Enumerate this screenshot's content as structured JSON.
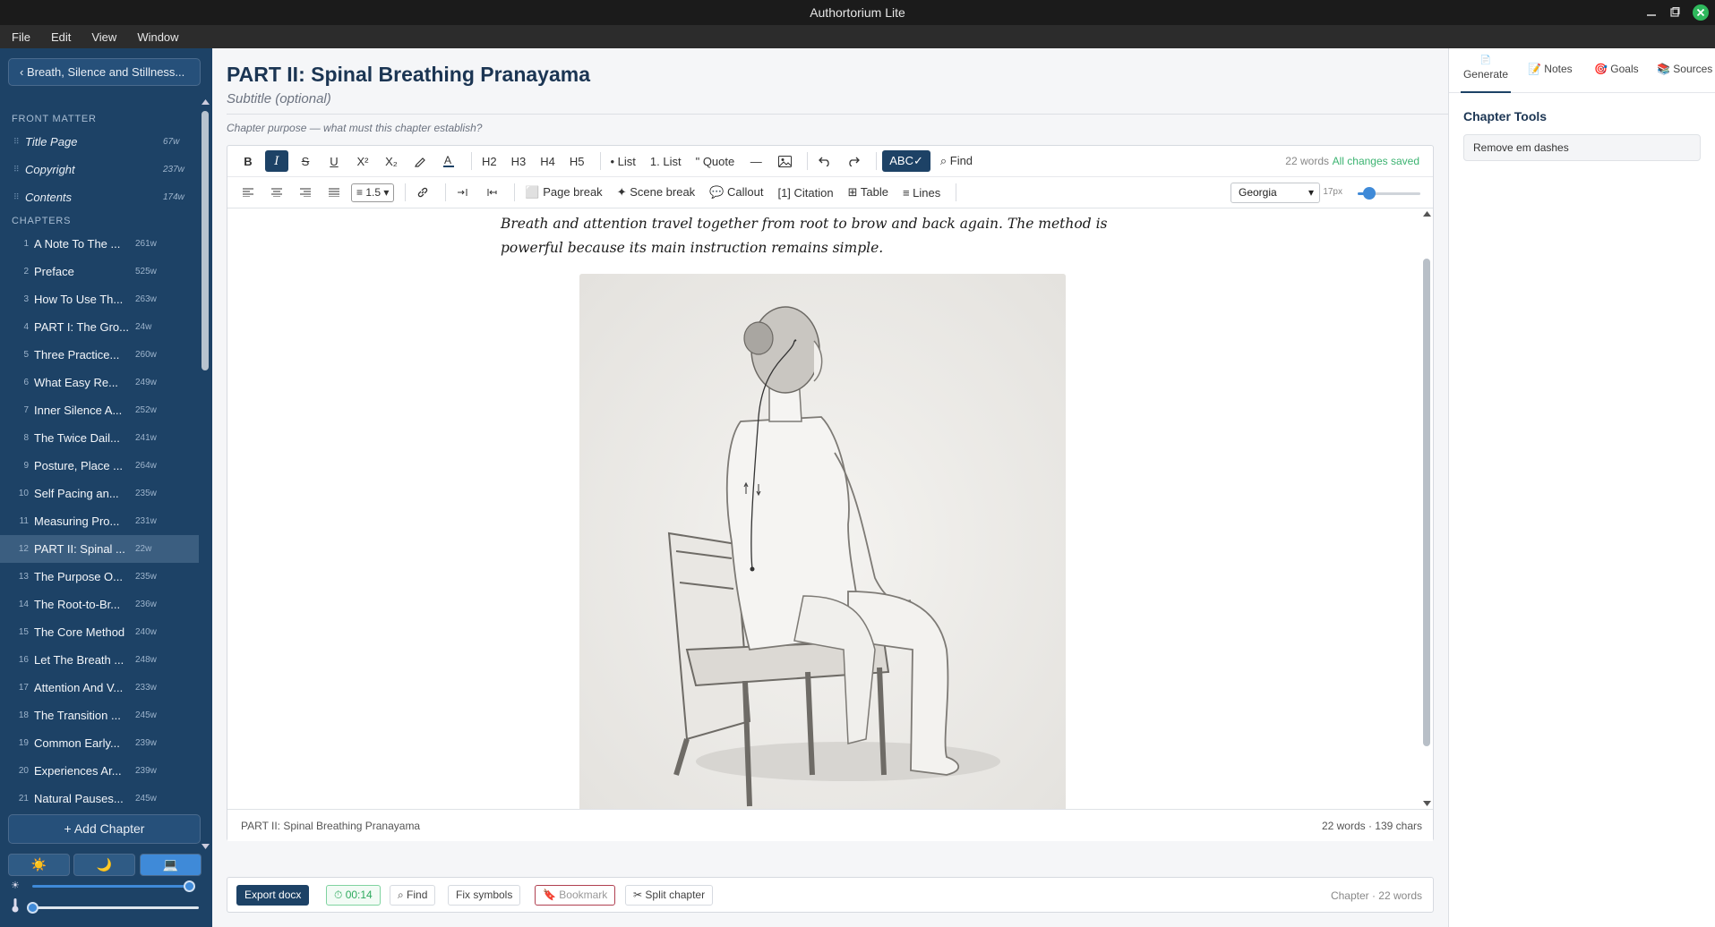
{
  "window": {
    "title": "Authortorium Lite"
  },
  "menu": [
    "File",
    "Edit",
    "View",
    "Window"
  ],
  "sidebar": {
    "back_label": "‹  Breath, Silence and Stillness...",
    "front_matter_heading": "FRONT MATTER",
    "front_matter": [
      {
        "title": "Title Page",
        "words": "67w"
      },
      {
        "title": "Copyright",
        "words": "237w"
      },
      {
        "title": "Contents",
        "words": "174w"
      }
    ],
    "chapters_heading": "CHAPTERS",
    "chapters": [
      {
        "n": "1",
        "title": "A Note To The ...",
        "words": "261w"
      },
      {
        "n": "2",
        "title": "Preface",
        "words": "525w"
      },
      {
        "n": "3",
        "title": "How To Use Th...",
        "words": "263w"
      },
      {
        "n": "4",
        "title": "PART I: The Gro...",
        "words": "24w"
      },
      {
        "n": "5",
        "title": "Three Practice...",
        "words": "260w"
      },
      {
        "n": "6",
        "title": "What Easy Re...",
        "words": "249w"
      },
      {
        "n": "7",
        "title": "Inner Silence A...",
        "words": "252w"
      },
      {
        "n": "8",
        "title": "The Twice Dail...",
        "words": "241w"
      },
      {
        "n": "9",
        "title": "Posture, Place ...",
        "words": "264w"
      },
      {
        "n": "10",
        "title": "Self Pacing an...",
        "words": "235w"
      },
      {
        "n": "11",
        "title": "Measuring Pro...",
        "words": "231w"
      },
      {
        "n": "12",
        "title": "PART II: Spinal ...",
        "words": "22w",
        "active": true
      },
      {
        "n": "13",
        "title": "The Purpose O...",
        "words": "235w"
      },
      {
        "n": "14",
        "title": "The Root-to-Br...",
        "words": "236w"
      },
      {
        "n": "15",
        "title": "The Core Method",
        "words": "240w"
      },
      {
        "n": "16",
        "title": "Let The Breath ...",
        "words": "248w"
      },
      {
        "n": "17",
        "title": "Attention And V...",
        "words": "233w"
      },
      {
        "n": "18",
        "title": "The Transition ...",
        "words": "245w"
      },
      {
        "n": "19",
        "title": "Common Early...",
        "words": "239w"
      },
      {
        "n": "20",
        "title": "Experiences Ar...",
        "words": "239w"
      },
      {
        "n": "21",
        "title": "Natural Pauses...",
        "words": "245w"
      }
    ],
    "add_chapter_label": "+ Add Chapter",
    "theme_icons": [
      "☀️",
      "🌙",
      "💻"
    ],
    "brightness_level": 0.97,
    "warmth_level": 0.0
  },
  "chapter": {
    "title": "PART II: Spinal Breathing Pranayama",
    "subtitle_placeholder": "Subtitle (optional)",
    "purpose_placeholder": "Chapter purpose — what must this chapter establish?",
    "body": "Breath and attention travel together from root to brow and back again. The method is powerful because its main instruction remains simple."
  },
  "toolbar": {
    "bold": "B",
    "italic": "I",
    "strike": "S",
    "underline": "U",
    "superscript": "X²",
    "subscript": "X₂",
    "h2": "H2",
    "h3": "H3",
    "h4": "H4",
    "h5": "H5",
    "bullet_list": "• List",
    "numbered_list": "1. List",
    "quote": "\" Quote",
    "hr": "—",
    "spellcheck": "ABC✓",
    "find": "⌕ Find",
    "word_count": "22 words",
    "save_status": "All changes saved",
    "line_height": "≡ 1.5",
    "page_break": "⬜ Page break",
    "scene_break": "✦ Scene break",
    "callout": "💬 Callout",
    "citation": "[1] Citation",
    "table": "⊞ Table",
    "lines": "≡ Lines",
    "font": "Georgia",
    "font_size": "17px",
    "font_size_level": 0.18
  },
  "editor_footer": {
    "chapter_name": "PART II: Spinal Breathing Pranayama",
    "stats": "22 words · 139 chars"
  },
  "bottom_bar": {
    "export": "Export docx",
    "timer": "⏱ 00:14",
    "find": "⌕ Find",
    "fix_symbols": "Fix symbols",
    "bookmark": "🔖 Bookmark",
    "split": "✂ Split chapter",
    "status": "Chapter · 22 words"
  },
  "right_panel": {
    "tabs": [
      "Generate",
      "📝 Notes",
      "🎯 Goals",
      "📚 Sources"
    ],
    "tools_heading": "Chapter Tools",
    "remove_em_dashes": "Remove em dashes"
  },
  "colors": {
    "sidebar": "#1d4266",
    "accent": "#3f8ad8",
    "saved": "#3cb371"
  }
}
